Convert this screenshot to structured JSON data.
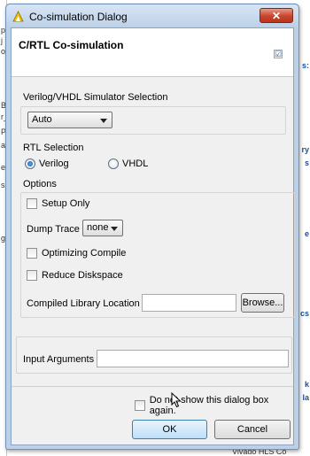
{
  "window": {
    "title": "Co-simulation Dialog",
    "close_label": "✕"
  },
  "header": {
    "title": "C/RTL Co-simulation",
    "check_mark": "☑"
  },
  "simulator": {
    "label": "Verilog/VHDL Simulator Selection",
    "selected": "Auto"
  },
  "rtl": {
    "label": "RTL Selection",
    "options": [
      {
        "label": "Verilog",
        "selected": true
      },
      {
        "label": "VHDL",
        "selected": false
      }
    ]
  },
  "options": {
    "label": "Options",
    "setup_only": {
      "label": "Setup Only",
      "checked": false
    },
    "dump_trace": {
      "label": "Dump Trace",
      "selected": "none"
    },
    "optimizing_compile": {
      "label": "Optimizing Compile",
      "checked": false
    },
    "reduce_diskspace": {
      "label": "Reduce Diskspace",
      "checked": false
    },
    "compiled_library": {
      "label": "Compiled Library Location",
      "value": "",
      "browse_label": "Browse..."
    }
  },
  "input_arguments": {
    "label": "Input Arguments",
    "value": ""
  },
  "footer": {
    "do_not_show": {
      "label": "Do not show this dialog box again.",
      "checked": false
    },
    "ok_label": "OK",
    "cancel_label": "Cancel"
  },
  "background": {
    "left_fragments": [
      "p",
      "j",
      "o",
      "B",
      "r_",
      "P",
      "a",
      "e",
      "s",
      "g"
    ],
    "right_fragments": [
      "s:",
      "ry",
      "s",
      "e",
      "cs",
      "k",
      "la"
    ],
    "bottom_text": "Vivado HLS Co"
  },
  "colors": {
    "title_bar": "#bcd0e7",
    "close_button": "#c8452c",
    "default_button": "#bedff8",
    "dialog_background": "#f0f0f0"
  }
}
